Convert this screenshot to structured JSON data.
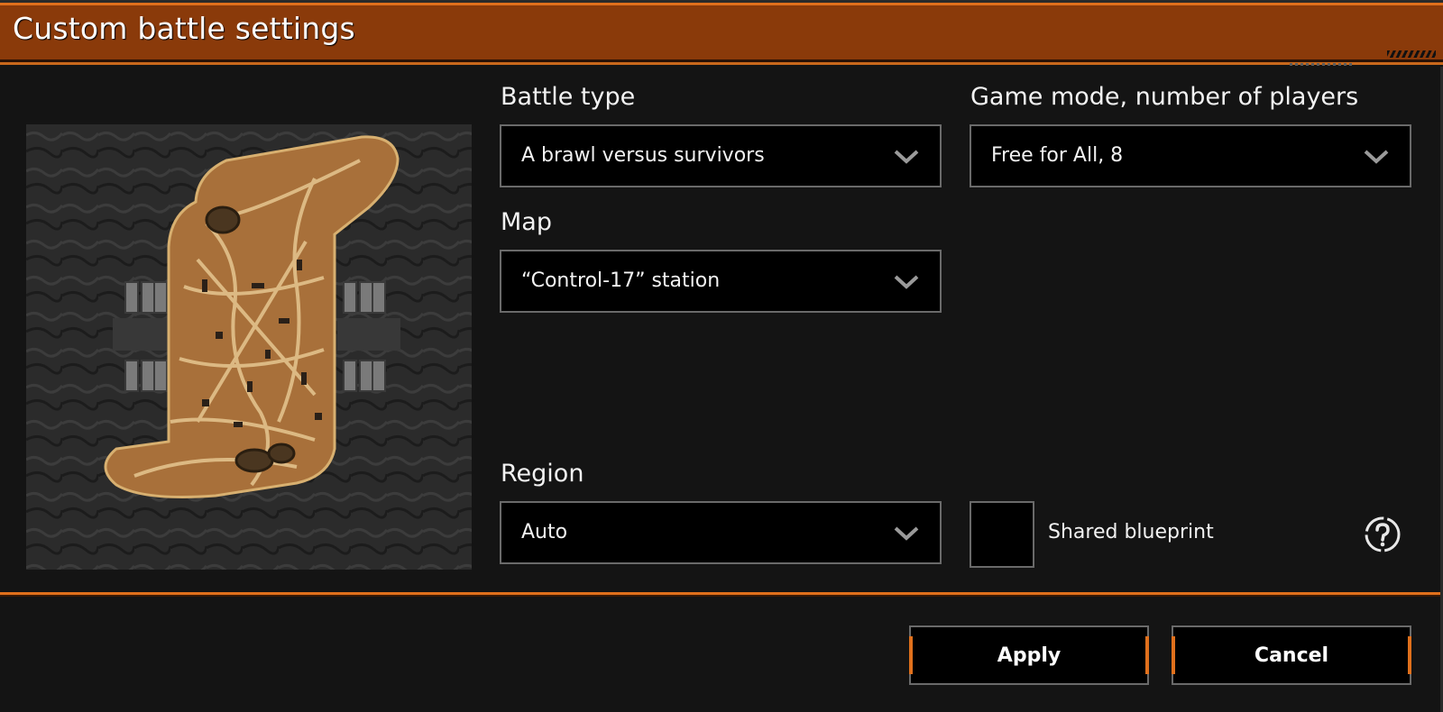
{
  "window": {
    "title": "Custom battle settings"
  },
  "fields": {
    "battle_type": {
      "label": "Battle type",
      "value": "A brawl versus survivors"
    },
    "game_mode": {
      "label": "Game mode, number of players",
      "value": "Free for All, 8"
    },
    "map": {
      "label": "Map",
      "value": "“Control-17” station"
    },
    "region": {
      "label": "Region",
      "value": "Auto"
    }
  },
  "shared_blueprint": {
    "label": "Shared blueprint",
    "checked": false
  },
  "buttons": {
    "apply": "Apply",
    "cancel": "Cancel"
  },
  "icons": {
    "dropdown": "chevron-down-icon",
    "help": "help-icon"
  },
  "colors": {
    "accent": "#e0701c",
    "titlebar": "#8a3a0a",
    "map_ground": "#a8703a"
  }
}
